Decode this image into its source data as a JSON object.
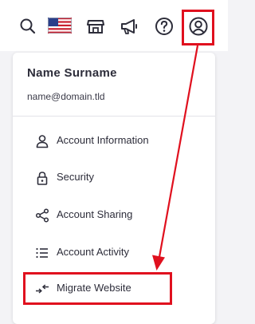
{
  "topbar": {
    "icons": [
      "search-icon",
      "us-flag-icon",
      "store-icon",
      "megaphone-icon",
      "help-icon",
      "account-icon"
    ]
  },
  "dropdown": {
    "user_name": "Name Surname",
    "user_email": "name@domain.tld",
    "items": [
      {
        "label": "Account Information",
        "icon": "user-icon"
      },
      {
        "label": "Security",
        "icon": "lock-icon"
      },
      {
        "label": "Account Sharing",
        "icon": "share-icon"
      },
      {
        "label": "Account Activity",
        "icon": "list-icon"
      },
      {
        "label": "Migrate Website",
        "icon": "migrate-arrows-icon"
      }
    ]
  },
  "colors": {
    "highlight": "#e0101e",
    "text": "#2d2d3a",
    "background": "#f3f3f6"
  }
}
